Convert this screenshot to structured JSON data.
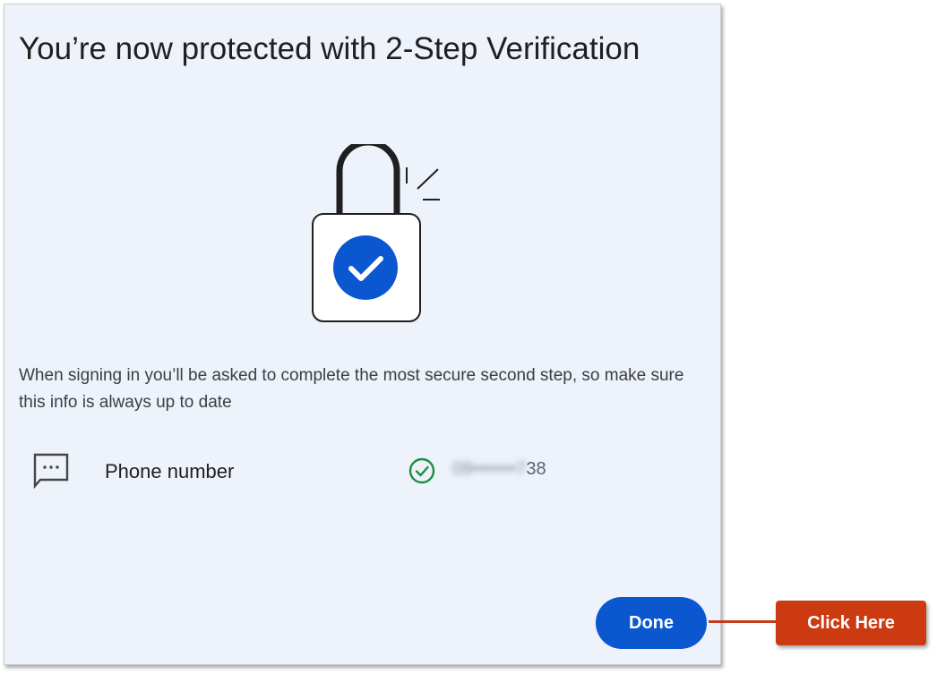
{
  "dialog": {
    "title": "You’re now protected with 2-Step Verification",
    "description": "When signing in you’ll be asked to complete the most secure second step, so make sure this info is always up to date",
    "illustration": {
      "icon": "lock-check-icon",
      "accent_color": "#0b57d0"
    },
    "methods": [
      {
        "icon": "message-icon",
        "label": "Phone number",
        "status_icon": "check-circle-icon",
        "status_color": "#1e8e3e",
        "value_hidden": "09•••••••7",
        "value_visible": "38"
      }
    ],
    "done_label": "Done",
    "done_color": "#0b57d0"
  },
  "annotation": {
    "callout_label": "Click Here",
    "callout_color": "#cc3a12"
  }
}
